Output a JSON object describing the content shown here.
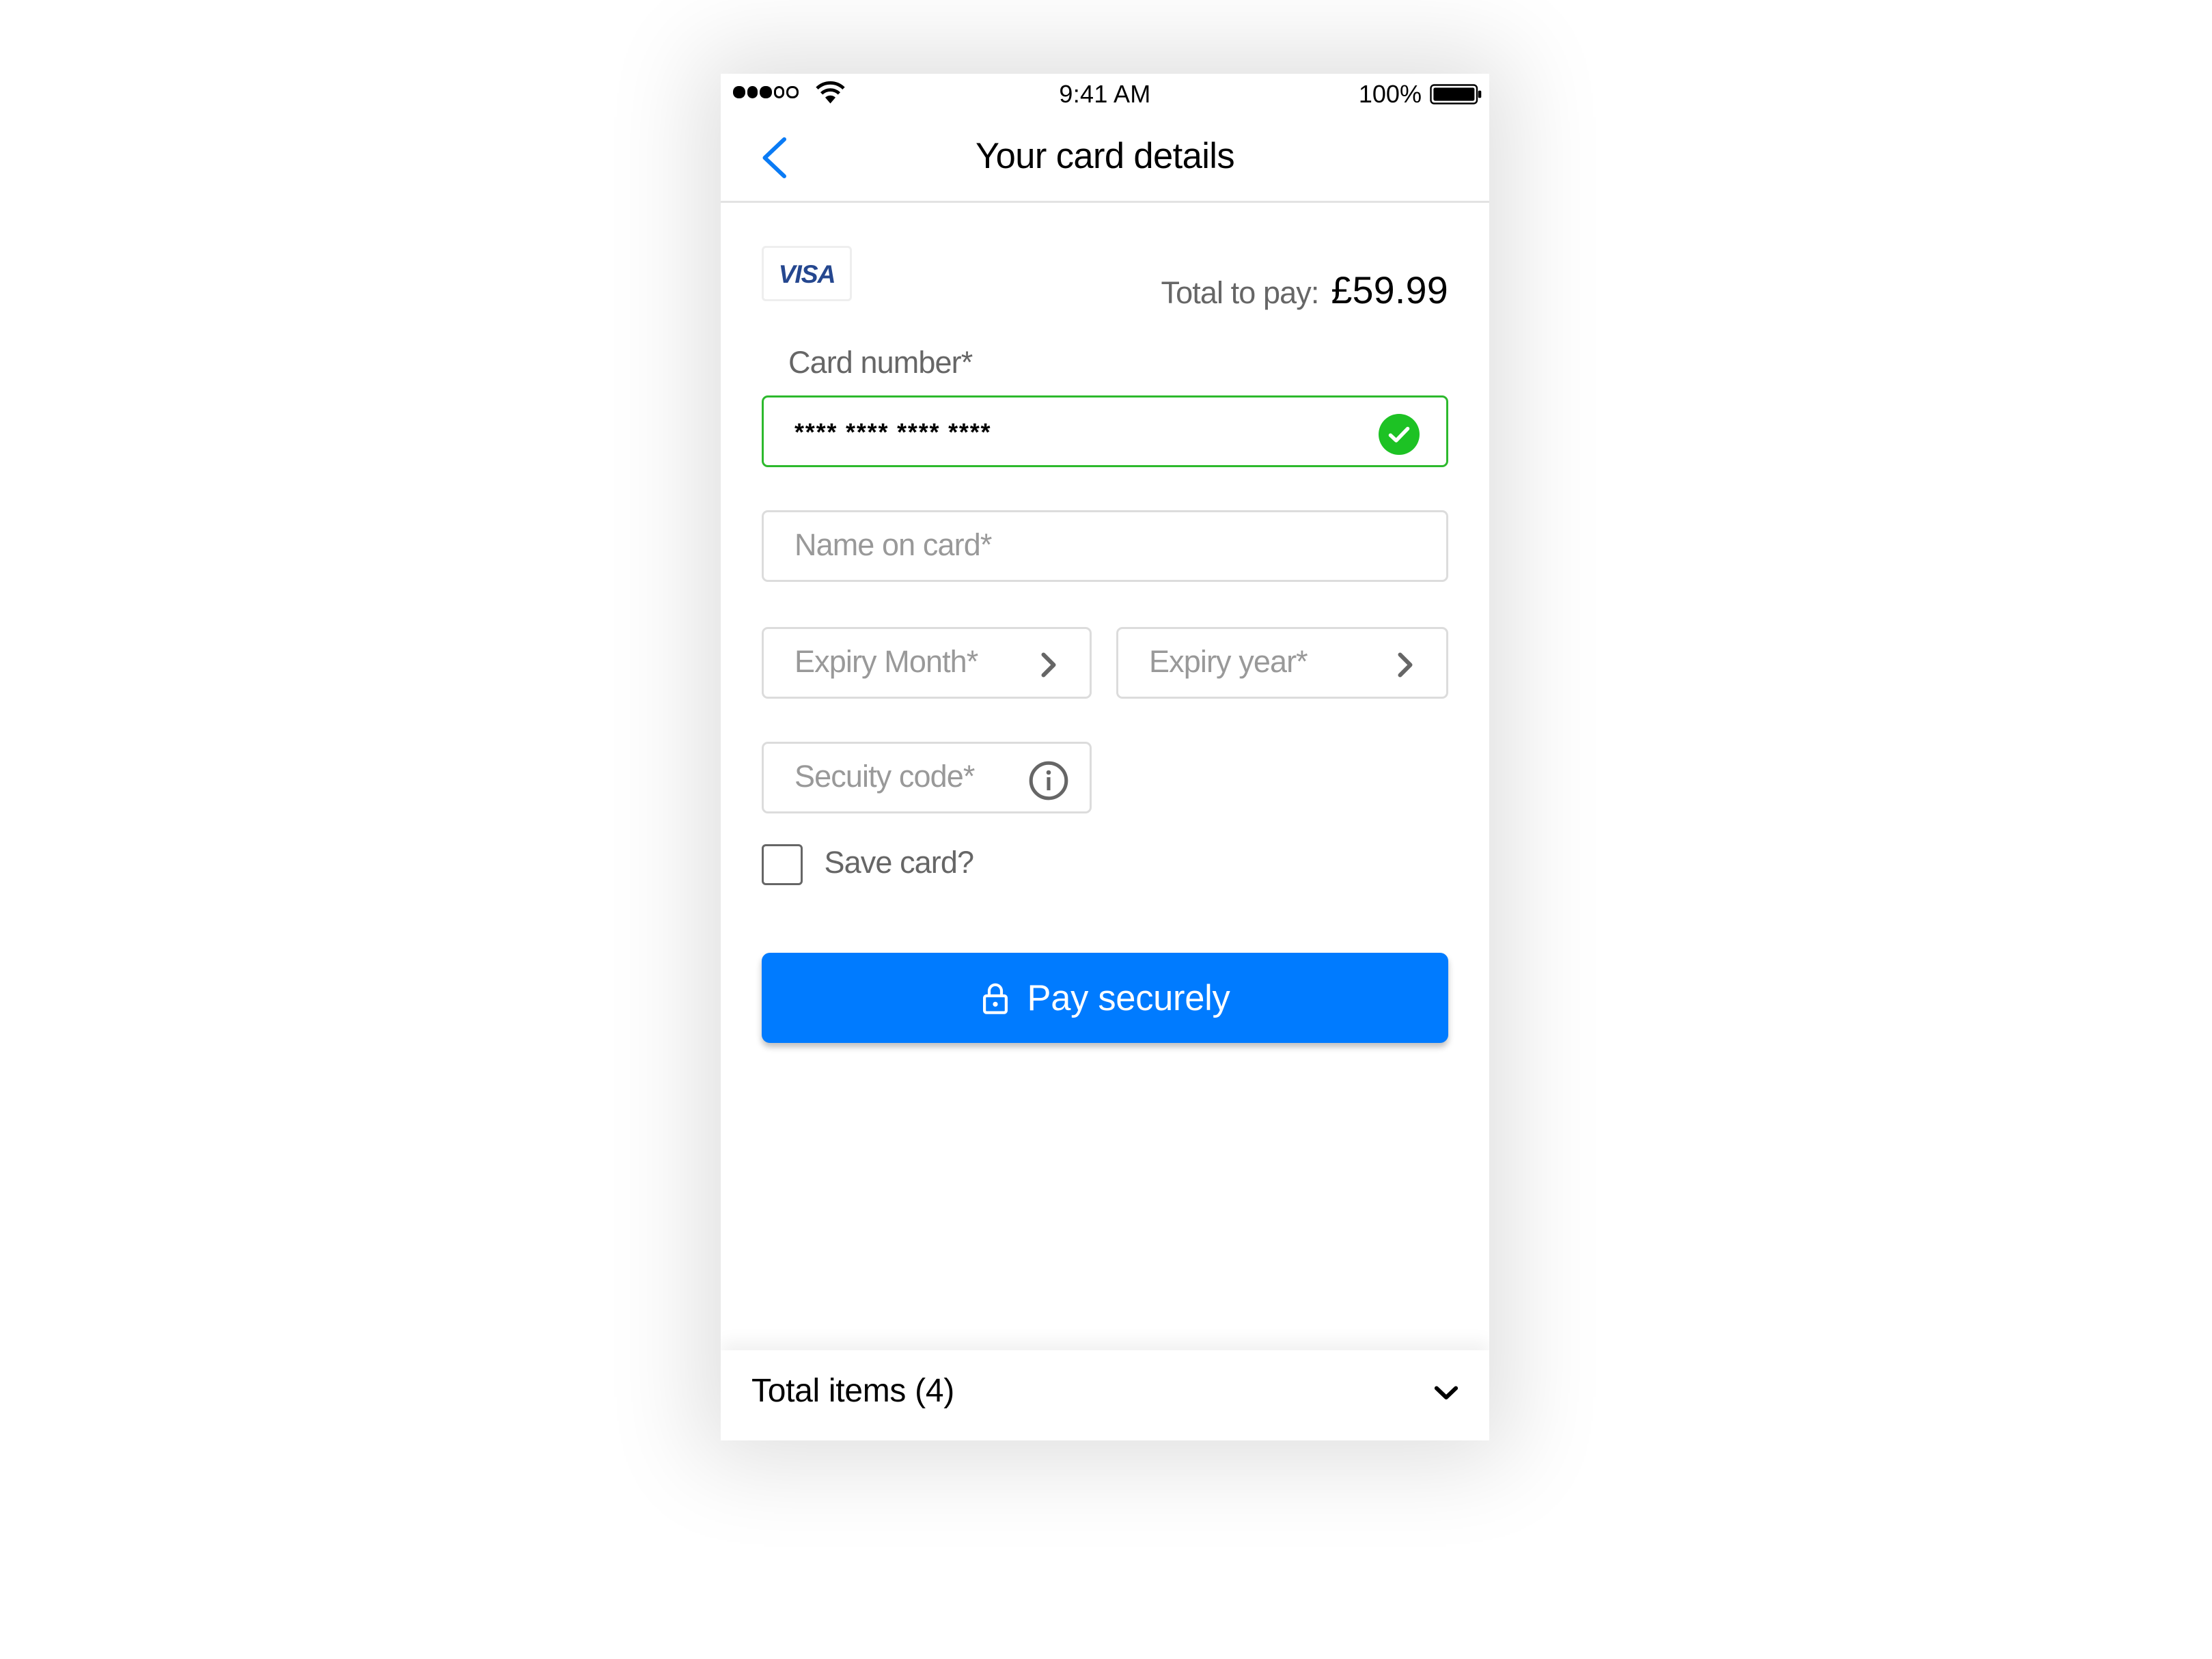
{
  "status_bar": {
    "signal_bars_filled": 3,
    "signal_bars_total": 5,
    "wifi_icon": "wifi-icon",
    "time": "9:41 AM",
    "battery_percent": "100%",
    "battery_level": 1.0
  },
  "nav": {
    "back_icon": "chevron-left-icon",
    "title": "Your card details"
  },
  "payment": {
    "card_brand": "VISA",
    "total_label": "Total to pay:",
    "total_amount": "£59.99"
  },
  "form": {
    "card_number": {
      "label": "Card number*",
      "value": "**** **** **** ****",
      "status_icon": "check-circle-icon",
      "valid": true
    },
    "name_on_card": {
      "placeholder": "Name on card*",
      "value": ""
    },
    "expiry_month": {
      "placeholder": "Expiry Month*",
      "icon": "chevron-right-icon"
    },
    "expiry_year": {
      "placeholder": "Expiry year*",
      "icon": "chevron-right-icon"
    },
    "security_code": {
      "placeholder": "Secuity code*",
      "icon": "info-icon"
    },
    "save_card": {
      "label": "Save card?",
      "checked": false
    },
    "submit": {
      "icon": "lock-icon",
      "label": "Pay securely"
    }
  },
  "footer": {
    "label": "Total items (4)",
    "icon": "chevron-down-icon"
  },
  "colors": {
    "accent": "#007bff",
    "valid": "#1dc224",
    "visa_blue": "#25478f",
    "placeholder": "#999999",
    "label": "#666666"
  }
}
